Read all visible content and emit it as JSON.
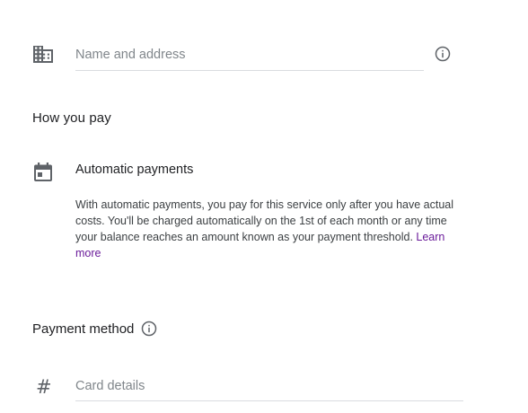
{
  "business_info": {
    "name_address_placeholder": "Name and address",
    "name_address_value": "",
    "icon": "building-icon",
    "info_icon": "info-icon"
  },
  "how_you_pay": {
    "heading": "How you pay",
    "automatic_payments": {
      "icon": "calendar-icon",
      "title": "Automatic payments",
      "description": "With automatic payments, you pay for this service only after you have actual costs. You'll be charged automatically on the 1st of each month or any time your balance reaches an amount known as your payment threshold.",
      "learn_more_label": "Learn more"
    }
  },
  "payment_method": {
    "heading": "Payment method",
    "info_icon": "info-icon",
    "card_icon": "#",
    "card_details_placeholder": "Card details",
    "card_details_value": ""
  },
  "colors": {
    "text_primary": "#202124",
    "text_secondary": "#3c4043",
    "placeholder": "#80868b",
    "icon": "#5f6368",
    "divider": "#dadce0",
    "link": "#6a1b9a"
  }
}
